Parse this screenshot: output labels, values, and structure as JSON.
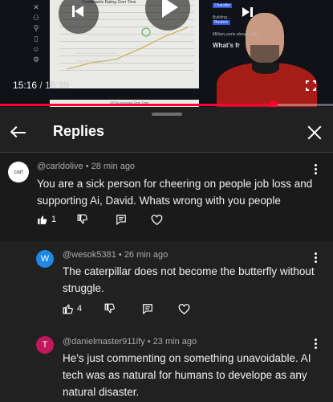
{
  "player": {
    "current_time": "15:16",
    "total_time": "18:39",
    "progress_fraction": 0.82,
    "accent_color": "#ff0033",
    "screen": {
      "chart_title": "Comfortable Rating Over Time",
      "chart_subtitle": "GPQA Accuracy Over Time",
      "news_items": [
        {
          "tag": "Chandler",
          "text": "Building..."
        },
        {
          "tag": "Reuters",
          "text": "Military parts ahead of Bi..."
        }
      ],
      "news_heading": "What's fr"
    }
  },
  "replies": {
    "title": "Replies",
    "top_comment": {
      "avatar_text": "carl",
      "author": "@carldolive",
      "time": "28 min ago",
      "text": "You are a sick person for cheering on people job loss and supporting Ai, David. Whats wrong with you people",
      "likes": "1"
    },
    "items": [
      {
        "avatar_letter": "W",
        "avatar_color": "#1e88e5",
        "author": "@wesok5381",
        "time": "26 min ago",
        "text": "The caterpillar does not become the butterfly without struggle.",
        "likes": "4"
      },
      {
        "avatar_letter": "T",
        "avatar_color": "#c2185b",
        "author": "@danielmaster911ify",
        "time": "23 min ago",
        "text": "He's just commenting on something unavoidable. AI tech was as natural for humans to develope as any natural disaster."
      }
    ],
    "separator": "•"
  }
}
